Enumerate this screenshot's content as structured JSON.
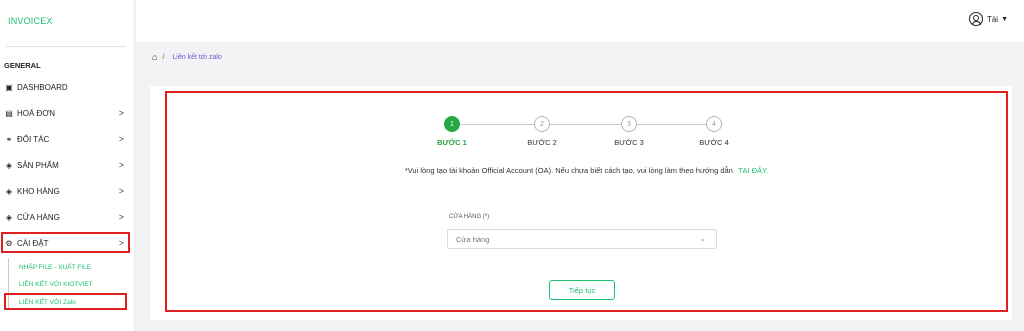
{
  "brand": "INVOICEX",
  "sidebar": {
    "section": "GENERAL",
    "items": [
      {
        "label": "DASHBOARD",
        "icon": "dashboard-icon"
      },
      {
        "label": "HOÁ ĐƠN",
        "icon": "invoice-icon",
        "chevron": ">"
      },
      {
        "label": "ĐỐI TÁC",
        "icon": "handshake-icon",
        "chevron": ">"
      },
      {
        "label": "SẢN PHẨM",
        "icon": "product-icon",
        "chevron": ">"
      },
      {
        "label": "KHO HÀNG",
        "icon": "warehouse-icon",
        "chevron": ">"
      },
      {
        "label": "CỬA HÀNG",
        "icon": "store-icon",
        "chevron": ">"
      },
      {
        "label": "CÀI ĐẶT",
        "icon": "settings-icon",
        "chevron": ">"
      }
    ],
    "subitems": [
      {
        "label": "NHẬP FILE - XUẤT FILE"
      },
      {
        "label": "LIÊN KẾT VỚI KIOTVIET"
      },
      {
        "label": "LIÊN KẾT VỚI Zalo"
      }
    ]
  },
  "header": {
    "user_name": "Tài",
    "user_icon": "user-circle-icon"
  },
  "breadcrumb": {
    "current": "Liên kết tới zalo"
  },
  "steps": [
    {
      "num": "1",
      "label": "BƯỚC 1",
      "active": true
    },
    {
      "num": "2",
      "label": "BƯỚC 2",
      "active": false
    },
    {
      "num": "3",
      "label": "BƯỚC 3",
      "active": false
    },
    {
      "num": "4",
      "label": "BƯỚC 4",
      "active": false
    }
  ],
  "notice": {
    "text": "*Vui lòng tạo tài khoản Official Account (OA). Nếu chưa biết cách tạo, vui lòng làm theo hướng dẫn",
    "link": "TẠI ĐÂY."
  },
  "form": {
    "label": "CỬA HÀNG (*)",
    "placeholder": "Cửa hàng"
  },
  "button": {
    "label": "Tiếp tục"
  },
  "colors": {
    "accent": "#1dbf73",
    "active_step": "#28a745",
    "highlight": "#e02020"
  }
}
